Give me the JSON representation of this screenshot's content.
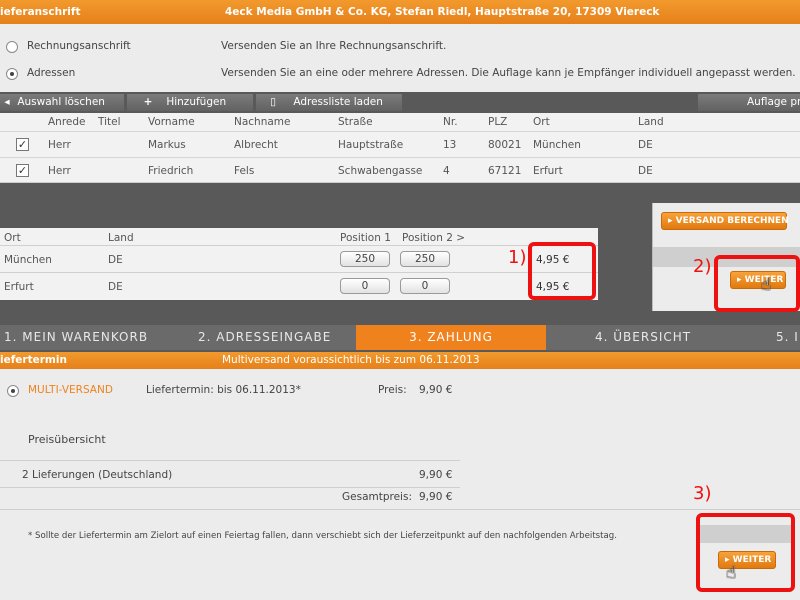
{
  "header": {
    "title": "ieferanschrift",
    "sender_info": "4eck Media GmbH & Co. KG, Stefan Riedl, Hauptstraße 20, 17309 Viereck"
  },
  "shipping_options": [
    {
      "label": "Rechnungsanschrift",
      "description": "Versenden Sie an Ihre Rechnungsanschrift.",
      "selected": false
    },
    {
      "label": "Adressen",
      "description": "Versenden Sie an eine oder mehrere Adressen. Die Auflage kann je Empfänger individuell angepasst werden.",
      "selected": true
    }
  ],
  "toolbar": {
    "clear_selection": "Auswahl löschen",
    "add": "Hinzufügen",
    "load_list": "Adressliste laden",
    "edition": "Auflage pr"
  },
  "address_table": {
    "headers": [
      "Anrede",
      "Titel",
      "Vorname",
      "Nachname",
      "Straße",
      "Nr.",
      "PLZ",
      "Ort",
      "Land"
    ],
    "rows": [
      {
        "checked": "✓",
        "anrede": "Herr",
        "titel": "",
        "vorname": "Markus",
        "nachname": "Albrecht",
        "strasse": "Hauptstraße",
        "nr": "13",
        "plz": "80021",
        "ort": "München",
        "land": "DE"
      },
      {
        "checked": "✓",
        "anrede": "Herr",
        "titel": "",
        "vorname": "Friedrich",
        "nachname": "Fels",
        "strasse": "Schwabengasse",
        "nr": "4",
        "plz": "67121",
        "ort": "Erfurt",
        "land": "DE"
      }
    ]
  },
  "position_table": {
    "headers": [
      "Ort",
      "Land",
      "Position 1",
      "Position 2 >"
    ],
    "rows": [
      {
        "ort": "München",
        "land": "DE",
        "pos1": "250",
        "pos2": "250",
        "price": "4,95 €"
      },
      {
        "ort": "Erfurt",
        "land": "DE",
        "pos1": "0",
        "pos2": "0",
        "price": "4,95 €"
      }
    ]
  },
  "buttons": {
    "calc_shipping": "▸ VERSAND BERECHNEN",
    "next": "▸ WEITER",
    "next_bottom": "▸ WEITER"
  },
  "annotations": [
    "1)",
    "2)",
    "3)"
  ],
  "steps": [
    {
      "label": "1. MEIN WARENKORB",
      "active": false
    },
    {
      "label": "2. ADRESSEINGABE",
      "active": false
    },
    {
      "label": "3. ZAHLUNG",
      "active": true
    },
    {
      "label": "4. ÜBERSICHT",
      "active": false
    },
    {
      "label": "5. I",
      "active": false
    }
  ],
  "delivery": {
    "header": "iefertermin",
    "estimate": "Multiversand voraussichtlich bis zum 06.11.2013",
    "option_label": "MULTI-VERSAND",
    "date_text": "Liefertermin: bis 06.11.2013*",
    "price_label": "Preis:",
    "price": "9,90 €"
  },
  "summary": {
    "title": "Preisübersicht",
    "line_label": "2 Lieferungen (Deutschland)",
    "line_price": "9,90 €",
    "total_label": "Gesamtpreis:",
    "total": "9,90 €",
    "footnote": "* Sollte der Liefertermin am Zielort auf einen Feiertag fallen, dann verschiebt sich der Lieferzeitpunkt auf den nachfolgenden Arbeitstag."
  },
  "colors": {
    "accent": "#f0821e",
    "annotation": "#ee1111"
  }
}
